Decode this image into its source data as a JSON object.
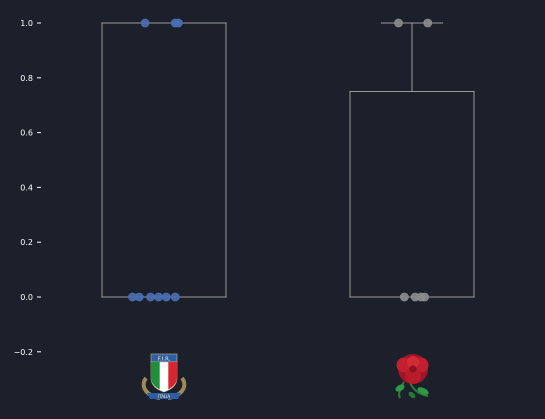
{
  "chart_data": {
    "type": "box",
    "ylim": [
      -0.25,
      1.05
    ],
    "y_ticks": [
      {
        "value": -0.2,
        "label": "−0.2"
      },
      {
        "value": 0.0,
        "label": "0.0"
      },
      {
        "value": 0.2,
        "label": "0.2"
      },
      {
        "value": 0.4,
        "label": "0.4"
      },
      {
        "value": 0.6,
        "label": "0.6"
      },
      {
        "value": 0.8,
        "label": "0.8"
      },
      {
        "value": 1.0,
        "label": "1.0"
      }
    ],
    "grid": false,
    "groups": [
      {
        "logo": "italy-rugby-fir-crest",
        "box": {
          "min": 0.0,
          "q1": 0.0,
          "median": 0.0,
          "q3": 1.0,
          "max": 1.0
        },
        "points": [
          {
            "x_offset": -0.42,
            "y": 1.0
          },
          {
            "x_offset": 0.25,
            "y": 1.0
          },
          {
            "x_offset": 0.32,
            "y": 1.0
          },
          {
            "x_offset": -0.7,
            "y": 0.0
          },
          {
            "x_offset": -0.55,
            "y": 0.0
          },
          {
            "x_offset": -0.3,
            "y": 0.0
          },
          {
            "x_offset": -0.12,
            "y": 0.0
          },
          {
            "x_offset": 0.05,
            "y": 0.0
          },
          {
            "x_offset": 0.25,
            "y": 0.0
          }
        ]
      },
      {
        "logo": "england-rugby-red-rose",
        "box": {
          "min": 0.0,
          "q1": 0.0,
          "median": 0.0,
          "q3": 0.75,
          "max": 1.0
        },
        "points": [
          {
            "x_offset": -0.3,
            "y": 1.0
          },
          {
            "x_offset": 0.35,
            "y": 1.0
          },
          {
            "x_offset": -0.17,
            "y": 0.0
          },
          {
            "x_offset": 0.07,
            "y": 0.0
          },
          {
            "x_offset": 0.2,
            "y": 0.0
          },
          {
            "x_offset": 0.28,
            "y": 0.0
          }
        ]
      }
    ]
  },
  "colors": {
    "background": "#1c202b",
    "box_stroke": "#9a9a9a",
    "axis": "#ffffff",
    "group_points": [
      "#4a6fb5",
      "#8c8c8c"
    ]
  }
}
